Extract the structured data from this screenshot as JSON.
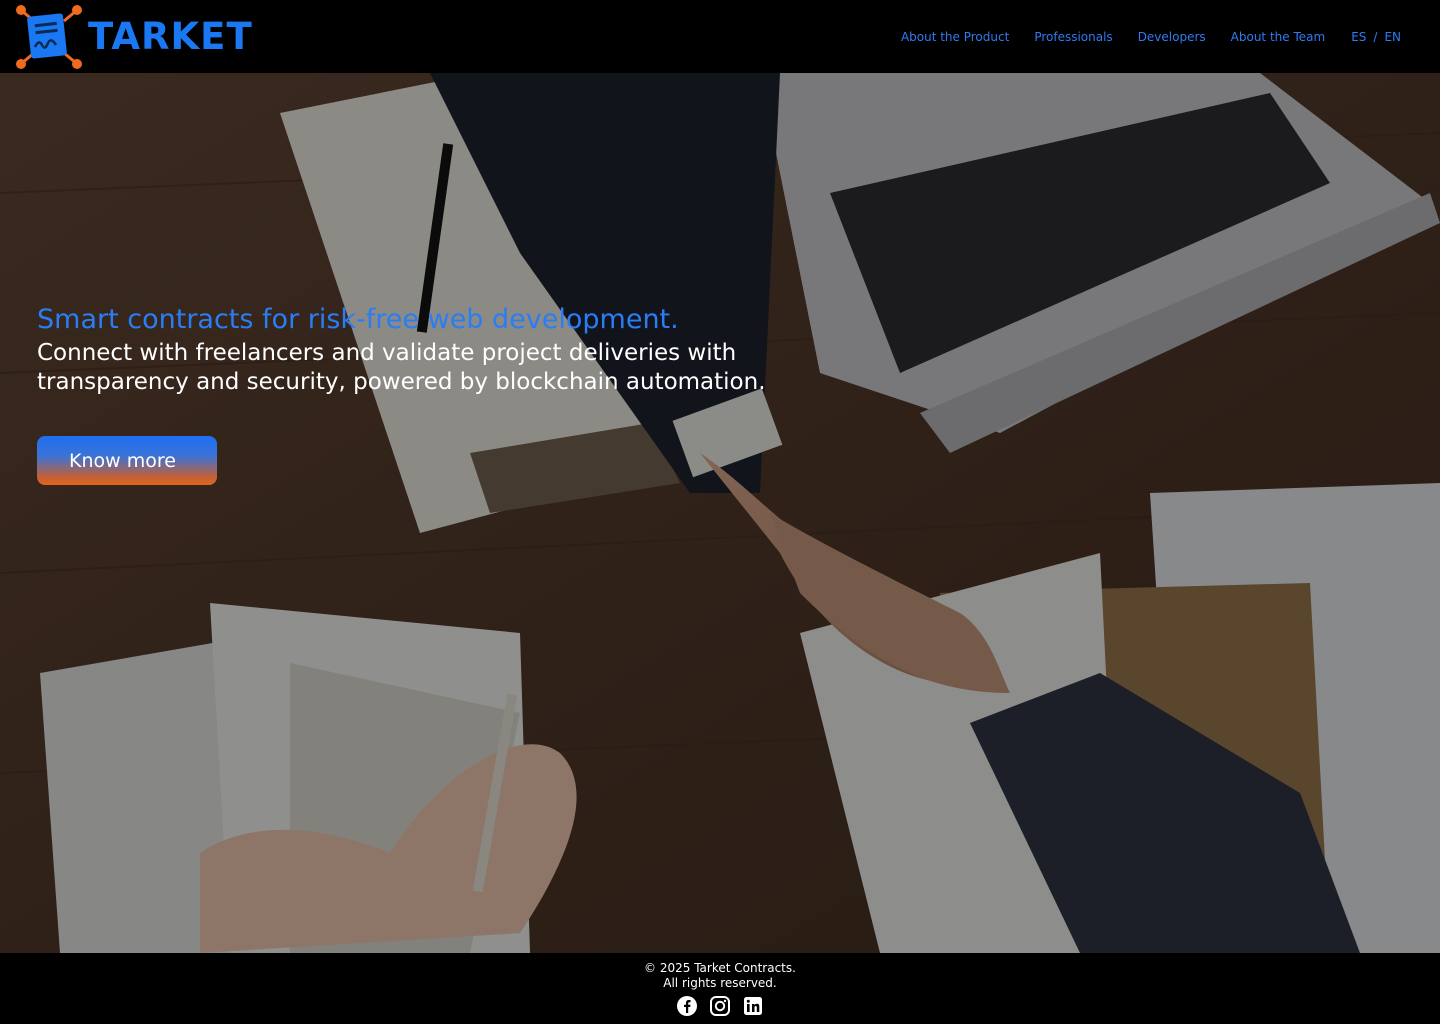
{
  "brand": {
    "name": "TARKET",
    "logo_icon": "contract-network-logo",
    "color": "#1a78f2",
    "node_color": "#f26a1b"
  },
  "nav": {
    "items": [
      {
        "label": "About the Product"
      },
      {
        "label": "Professionals"
      },
      {
        "label": "Developers"
      },
      {
        "label": "About the Team"
      }
    ],
    "lang": {
      "es": "ES",
      "sep": "/",
      "en": "EN"
    }
  },
  "hero": {
    "headline": "Smart contracts for risk-free web development.",
    "subtext": "Connect with freelancers and validate project deliveries with transparency and security, powered by blockchain automation.",
    "cta_label": "Know more",
    "background_icon": "handshake-desk-photo"
  },
  "footer": {
    "copyright": "© 2025 Tarket Contracts.",
    "rights": "All rights reserved.",
    "social": [
      {
        "icon": "facebook-icon"
      },
      {
        "icon": "instagram-icon"
      },
      {
        "icon": "linkedin-icon"
      }
    ]
  }
}
